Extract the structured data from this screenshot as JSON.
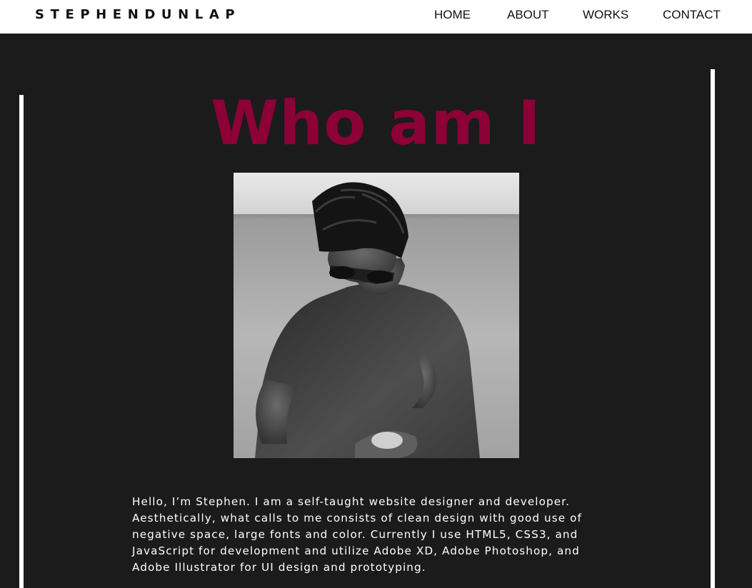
{
  "brand": {
    "logo_text": "STEPHENDUNLAP"
  },
  "nav": {
    "items": [
      {
        "label": "HOME"
      },
      {
        "label": "ABOUT"
      },
      {
        "label": "WORKS"
      },
      {
        "label": "CONTACT"
      }
    ]
  },
  "about": {
    "title": "Who am I",
    "bio": "Hello, I’m Stephen. I am a self-taught website designer and developer. Aesthetically, what calls to me consists of clean design with good use of negative space, large fonts and color. Currently I use HTML5, CSS3, and JavaScript for development and utilize Adobe XD, Adobe Photoshop, and Adobe Illustrator for UI design and prototyping."
  },
  "colors": {
    "background": "#1b1b1b",
    "navbar": "#ffffff",
    "accent": "#8c0136",
    "text": "#ffffff"
  }
}
